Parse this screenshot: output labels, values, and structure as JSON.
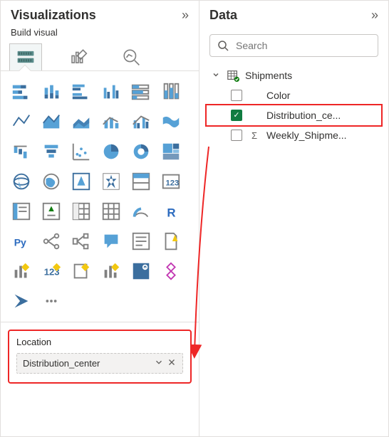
{
  "visualizations": {
    "title": "Visualizations",
    "subtitle": "Build visual",
    "tabs": {
      "build": "Build",
      "format": "Format",
      "analytics": "Analytics"
    },
    "well": {
      "title": "Location",
      "field": "Distribution_center"
    },
    "gallery": [
      "stacked-bar",
      "stacked-column",
      "clustered-bar",
      "clustered-column",
      "100-stacked-bar",
      "100-stacked-column",
      "line",
      "area",
      "stacked-area",
      "line-stacked-column",
      "line-clustered-column",
      "ribbon",
      "waterfall",
      "funnel",
      "scatter",
      "pie",
      "donut",
      "treemap",
      "map",
      "filled-map",
      "azure-map",
      "arcgis",
      "slicer",
      "card",
      "multi-row-card",
      "kpi",
      "matrix",
      "table",
      "gauge",
      "r-visual",
      "python-visual",
      "key-influencers",
      "decomposition-tree",
      "q-and-a",
      "narrative-smart",
      "paginated-report",
      "power-apps",
      "power-automate",
      "more-visuals"
    ]
  },
  "data": {
    "title": "Data",
    "search_placeholder": "Search",
    "tables": [
      {
        "name": "Shipments",
        "expanded": true,
        "fields": [
          {
            "name": "Color",
            "checked": false,
            "type": ""
          },
          {
            "name": "Distribution_ce...",
            "checked": true,
            "type": ""
          },
          {
            "name": "Weekly_Shipme...",
            "checked": false,
            "type": "Σ"
          }
        ]
      }
    ]
  }
}
